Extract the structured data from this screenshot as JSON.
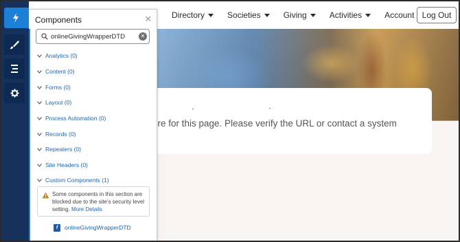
{
  "site": {
    "nav": [
      {
        "label": "Directory"
      },
      {
        "label": "Societies"
      },
      {
        "label": "Giving"
      },
      {
        "label": "Activities"
      },
      {
        "label": "Account"
      }
    ],
    "logout_label": "Log Out",
    "error_message": "ere for this page. Please verify the URL or contact a system"
  },
  "rail": {
    "buttons": [
      {
        "icon": "lightning-bolt-icon",
        "active": true
      },
      {
        "icon": "brush-icon",
        "active": false
      },
      {
        "icon": "page-structure-icon",
        "active": false
      },
      {
        "icon": "gear-icon",
        "active": false
      }
    ]
  },
  "panel": {
    "title": "Components",
    "search_value": "onlineGivingWrapperDTD",
    "categories": [
      {
        "label": "Analytics (0)",
        "expanded": false
      },
      {
        "label": "Content (0)",
        "expanded": false
      },
      {
        "label": "Forms (0)",
        "expanded": false
      },
      {
        "label": "Layout (0)",
        "expanded": false
      },
      {
        "label": "Process Automation (0)",
        "expanded": false
      },
      {
        "label": "Records (0)",
        "expanded": false
      },
      {
        "label": "Repeaters (0)",
        "expanded": false
      },
      {
        "label": "Site Headers (0)",
        "expanded": false
      },
      {
        "label": "Custom Components (1)",
        "expanded": true
      }
    ],
    "warning": {
      "text": "Some components in this section are blocked due to the site's security level setting.",
      "link": "More Details"
    },
    "component_item": "onlineGivingWrapperDTD"
  },
  "colors": {
    "rail": "#16325c",
    "rail_active": "#1b80d6",
    "link": "#1b66b3",
    "warning": "#c7871a"
  }
}
